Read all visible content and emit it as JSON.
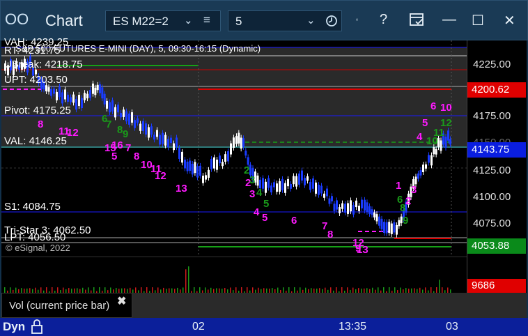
{
  "window": {
    "title": "Chart",
    "symbol": "ES M22=2",
    "interval": "5",
    "close_button": "✕",
    "restore_button": "☐",
    "minimize_button": "—",
    "help_button": "?"
  },
  "chart": {
    "legend": "S&P 500 FUTURES E-MINI (DAY), 5, 09:30-16:15 (Dynamic)",
    "copyright": "© eSignal, 2022",
    "levels": {
      "vah": "VAH: 4239.25",
      "rt": "RT: 4231.75",
      "ubreak": "UBreak: 4218.75",
      "upt": "UPT: 4203.50",
      "pivot": "Pivot: 4175.25",
      "val": "VAL: 4146.25",
      "s1": "S1: 4084.75",
      "tristar": "Tri-Star 3: 4062.50",
      "lpt": "LPT: 4056.50"
    },
    "axis_labels": [
      "4225.00",
      "4175.00",
      "4150.00",
      "4125.00",
      "4100.00",
      "4075.00"
    ],
    "price_boxes": {
      "upper": "4200.62",
      "current": "4143.75",
      "lower": "4053.88"
    },
    "markers_magenta": [
      "8",
      "11",
      "12",
      "15",
      "16",
      "7",
      "5",
      "8",
      "10",
      "11",
      "12",
      "13",
      "2",
      "3",
      "4",
      "5",
      "6",
      "7",
      "8",
      "9",
      "12",
      "13",
      "1",
      "2",
      "3",
      "4",
      "5",
      "6",
      "10"
    ],
    "markers_green": [
      "6",
      "7",
      "8",
      "9",
      "2",
      "3",
      "4",
      "5",
      "6",
      "8",
      "9",
      "10",
      "11",
      "12"
    ],
    "colors": {
      "upper_box": "#e00000",
      "current_box": "#0a1ee0",
      "lower_box": "#0a8a1a",
      "down_candle": "#1a3cff",
      "up_candle": "#ffffff"
    }
  },
  "volume": {
    "label": "Vol (current price bar)",
    "value": "9686",
    "close_icon": "✖"
  },
  "time_axis": {
    "mode": "Dyn",
    "labels": [
      "02",
      "13:35",
      "03"
    ]
  }
}
